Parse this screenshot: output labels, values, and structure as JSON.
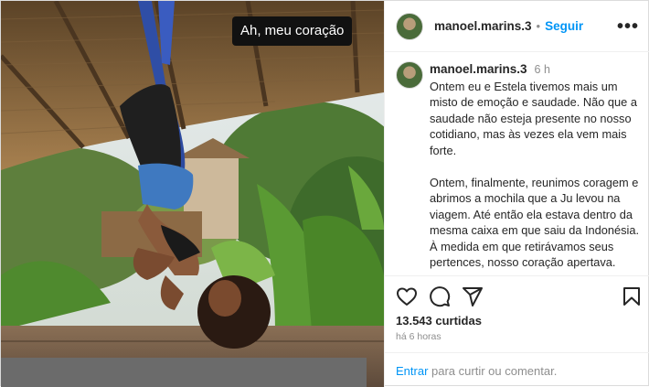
{
  "photo": {
    "sticker_text": "Ah, meu coração"
  },
  "header": {
    "username": "manoel.marins.3",
    "separator": "•",
    "follow_label": "Seguir",
    "more_label": "•••"
  },
  "caption": {
    "username": "manoel.marins.3",
    "time": "6 h",
    "paragraphs": [
      "Ontem eu e Estela tivemos mais um misto de emoção e saudade. Não que a saudade não esteja presente no nosso cotidiano, mas às vezes ela vem mais forte.",
      "Ontem, finalmente, reunimos coragem e abrimos a mochila que a Ju levou na viagem. Até então ela estava dentro da mesma caixa em que saiu da Indonésia. À medida em que retirávamos seus pertences, nosso coração apertava. Cada peça de roupa, cada objeto, nos remetia"
    ]
  },
  "actions": {
    "like_icon": "heart-icon",
    "comment_icon": "comment-icon",
    "share_icon": "share-icon",
    "save_icon": "bookmark-icon"
  },
  "likes_text": "13.543 curtidas",
  "time_ago": "há 6 horas",
  "footer": {
    "login_link": "Entrar",
    "rest": " para curtir ou comentar."
  },
  "colors": {
    "link_blue": "#0095f6",
    "muted": "#8e8e8e",
    "text": "#262626",
    "sticker_bg": "#111111"
  }
}
